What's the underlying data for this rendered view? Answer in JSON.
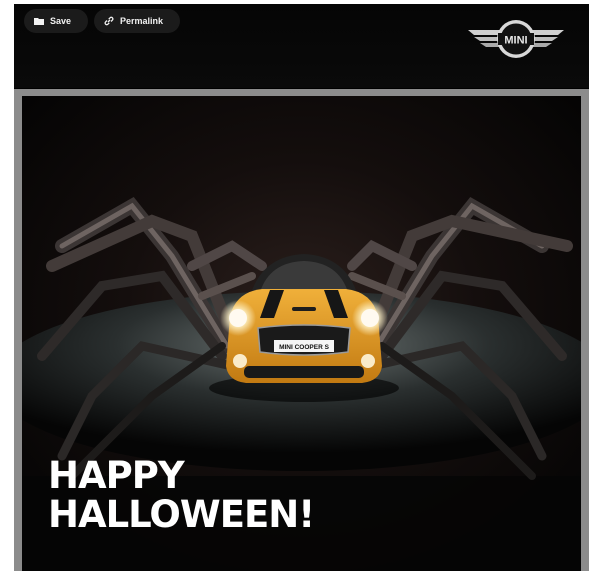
{
  "toolbar": {
    "save_label": "Save",
    "save_icon": "folder-icon",
    "permalink_label": "Permalink",
    "permalink_icon": "link-icon"
  },
  "brand": {
    "logo_text": "MINI",
    "logo_icon": "mini-wings-logo"
  },
  "image": {
    "plate_text": "MINI COOPER S",
    "headline_line1": "HAPPY",
    "headline_line2": "HALLOWEEN!"
  },
  "colors": {
    "background": "#000000",
    "border": "#8c8c8c",
    "car_orange": "#e49b1c",
    "text": "#ffffff"
  }
}
